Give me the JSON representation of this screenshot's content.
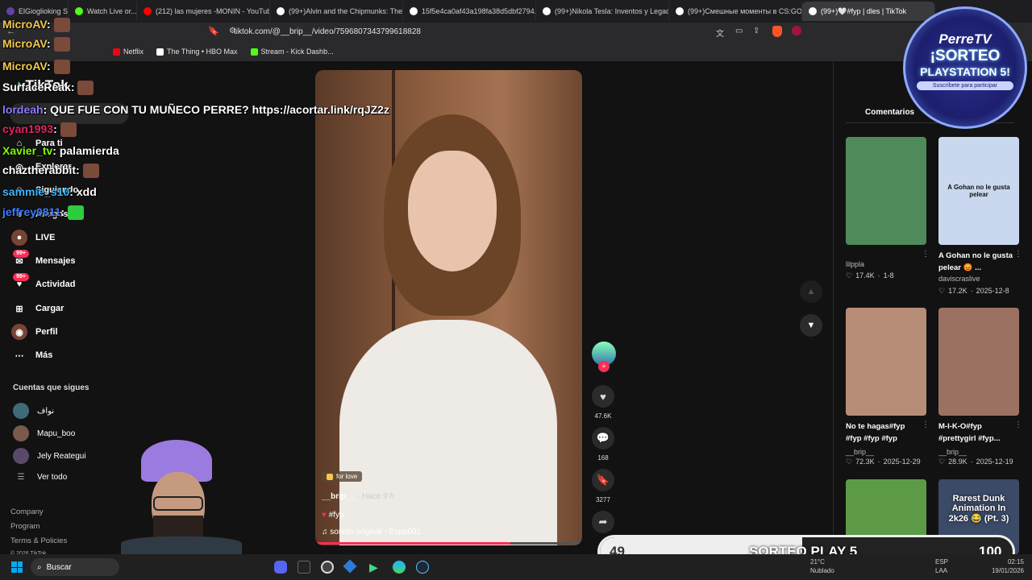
{
  "browser": {
    "tabs": [
      {
        "label": "ElGioglioking Strea...",
        "color": "#6441a5"
      },
      {
        "label": "Watch Live or...",
        "color": "#53fc18"
      },
      {
        "label": "(212) las mujeres -MONIN - YouTube",
        "color": "#ff0000"
      },
      {
        "label": "(99+)Alvin and the Chipmunks: The...",
        "color": "#ffffff"
      },
      {
        "label": "15f5e4ca0af43a198fa38d5dbf2794...",
        "color": "#ffffff"
      },
      {
        "label": "(99+)Nikola Tesla: Inventos y Legad...",
        "color": "#ffffff"
      },
      {
        "label": "(99+)Смешные моменты в CS:GO...",
        "color": "#ffffff"
      },
      {
        "label": "(99+)🤍#fyp | dles | TikTok",
        "color": "#ffffff"
      }
    ],
    "url": "tiktok.com/@__brip__/video/7596807343799618828",
    "bookmarks": [
      {
        "label": "Netflix",
        "icon": "netflix-icon"
      },
      {
        "label": "The Thing • HBO Max",
        "icon": "hbo-icon"
      },
      {
        "label": "Stream - Kick Dashb...",
        "icon": "kick-icon"
      }
    ]
  },
  "tiktok": {
    "logo": "TikTok",
    "nav": [
      {
        "label": "Para ti",
        "icon": "home-icon"
      },
      {
        "label": "Explorar",
        "icon": "compass-icon"
      },
      {
        "label": "Siguiendo",
        "icon": "following-icon"
      },
      {
        "label": "Amigos",
        "icon": "friends-icon"
      },
      {
        "label": "LIVE",
        "icon": "live-icon"
      },
      {
        "label": "Mensajes",
        "icon": "message-icon",
        "badge": "99+"
      },
      {
        "label": "Actividad",
        "icon": "activity-icon",
        "badge": "99+"
      },
      {
        "label": "Cargar",
        "icon": "upload-icon"
      },
      {
        "label": "Perfil",
        "icon": "profile-icon"
      },
      {
        "label": "Más",
        "icon": "more-icon"
      }
    ],
    "following_title": "Cuentas que sigues",
    "following": [
      "نواف",
      "Mapu_boo",
      "Jely Reategui"
    ],
    "see_all": "Ver todo",
    "footer": [
      "Company",
      "Program",
      "Terms & Policies",
      "© 2026 TikTok"
    ],
    "video": {
      "tag": "for love",
      "author": "__brip__",
      "time": "· Hace 9 h",
      "hashtag": "#fyp",
      "sound": "sonido original - Espa001",
      "progress": 0.73
    },
    "actions": {
      "likes": "47.6K",
      "comments": "168",
      "saves": "3277"
    },
    "comments_tab": "Comentarios",
    "related": [
      {
        "caption": "",
        "user": "lilppla",
        "likes": "17.4K",
        "date": "1-8",
        "thumb_color": "#4e8a5a",
        "overlay": ""
      },
      {
        "caption": "A Gohan no le gusta pelear 😡 ...",
        "user": "daviscraslive",
        "likes": "17.2K",
        "date": "2025-12-8",
        "thumb_color": "#c9d8ee",
        "overlay": "A Gohan no le gusta pelear"
      },
      {
        "caption": "No te hagas#fyp #fyp #fyp #fyp",
        "user": "__brip__",
        "likes": "72.3K",
        "date": "2025-12-29",
        "thumb_color": "#b88d78",
        "overlay": ""
      },
      {
        "caption": "M-I-K-O#fyp #prettygirl #fyp...",
        "user": "__brip__",
        "likes": "28.9K",
        "date": "2025-12-19",
        "thumb_color": "#9b7262",
        "overlay": ""
      },
      {
        "caption": "",
        "user": "",
        "likes": "",
        "date": "",
        "thumb_color": "#5c9a48",
        "overlay": ""
      },
      {
        "caption": "",
        "user": "",
        "likes": "",
        "date": "",
        "thumb_color": "#3b4a66",
        "overlay": "Rarest Dunk Animation In 2k26 😂 (Pt. 3)"
      }
    ]
  },
  "chat": [
    {
      "user": "MicroAV",
      "msg": "",
      "color": "#f2c94c"
    },
    {
      "user": "MicroAV",
      "msg": "",
      "color": "#f2c94c"
    },
    {
      "user": "MicroAV",
      "msg": "",
      "color": "#f2c94c"
    },
    {
      "user": "SurfaceReak",
      "msg": "",
      "color": "#ffffff"
    },
    {
      "user": "lordeah",
      "msg": "QUE FUE CON TU MUÑECO PERRE? https://acortar.link/rqJZ2z",
      "color": "#8a7cff"
    },
    {
      "user": "cyan1993",
      "msg": "",
      "color": "#e0245e"
    },
    {
      "user": "Xavier_tv",
      "msg": "palamierda",
      "color": "#7cfc00"
    },
    {
      "user": "chaztherabbit",
      "msg": "",
      "color": "#ffffff"
    },
    {
      "user": "sammie_s10",
      "msg": "xdd",
      "color": "#3cb4ff"
    },
    {
      "user": "jeffrey0811",
      "msg": "",
      "color": "#3c7cff"
    }
  ],
  "overlay": {
    "brand": "PerreTV",
    "title1": "¡SORTEO",
    "title2": "PLAYSTATION 5!",
    "subtitle": "Suscríbete para participar",
    "bar_label": "SORTEO PLAY 5",
    "bar_current": "49",
    "bar_goal": "100",
    "bar_fraction": 0.49
  },
  "taskbar": {
    "search": "Buscar",
    "weather": "21°C",
    "weather_sub": "Nublado",
    "lang": "ESP",
    "lang_sub": "LAA",
    "time": "02:15",
    "date": "19/01/2026"
  }
}
